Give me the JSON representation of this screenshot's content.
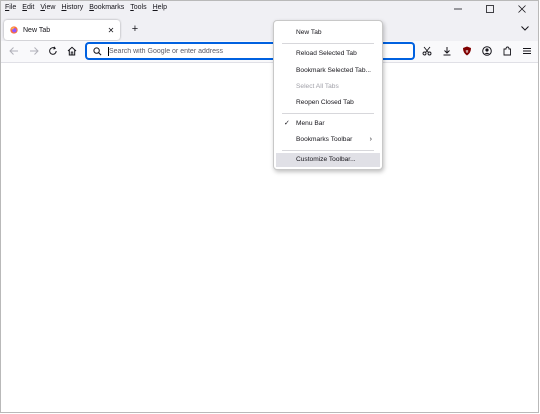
{
  "menubar": {
    "items": [
      "File",
      "Edit",
      "View",
      "History",
      "Bookmarks",
      "Tools",
      "Help"
    ]
  },
  "window_controls": {
    "minimize_icon": "minimize-icon",
    "maximize_icon": "maximize-icon",
    "close_icon": "close-icon"
  },
  "tabs": [
    {
      "title": "New Tab",
      "icon": "firefox-icon",
      "active": true
    }
  ],
  "tabstrip": {
    "new_tab_icon": "plus-icon",
    "list_all_tabs_icon": "chevron-down-icon"
  },
  "navbar": {
    "back_icon": "back-arrow-icon",
    "forward_icon": "forward-arrow-icon",
    "reload_icon": "reload-icon",
    "home_icon": "home-icon",
    "search": {
      "value": "",
      "placeholder": "Search with Google or enter address",
      "icon": "search-icon"
    },
    "toolbar_icons": [
      "screenshot-icon",
      "downloads-icon",
      "ublock-shield-icon",
      "account-icon",
      "extensions-icon",
      "hamburger-menu-icon"
    ]
  },
  "context_menu": {
    "items": [
      {
        "label": "New Tab",
        "enabled": true
      },
      {
        "label": "Reload Selected Tab",
        "enabled": true
      },
      {
        "label": "Bookmark Selected Tab...",
        "enabled": true
      },
      {
        "label": "Select All Tabs",
        "enabled": false
      },
      {
        "label": "Reopen Closed Tab",
        "enabled": true
      },
      {
        "label": "Menu Bar",
        "enabled": true,
        "checked": true
      },
      {
        "label": "Bookmarks Toolbar",
        "enabled": true,
        "submenu": true
      },
      {
        "label": "Customize Toolbar...",
        "enabled": true,
        "highlighted": true
      }
    ]
  },
  "colors": {
    "chrome_bg": "#f0f0f4",
    "urlbar_focus": "#0061e0",
    "ublock_red": "#800000"
  }
}
